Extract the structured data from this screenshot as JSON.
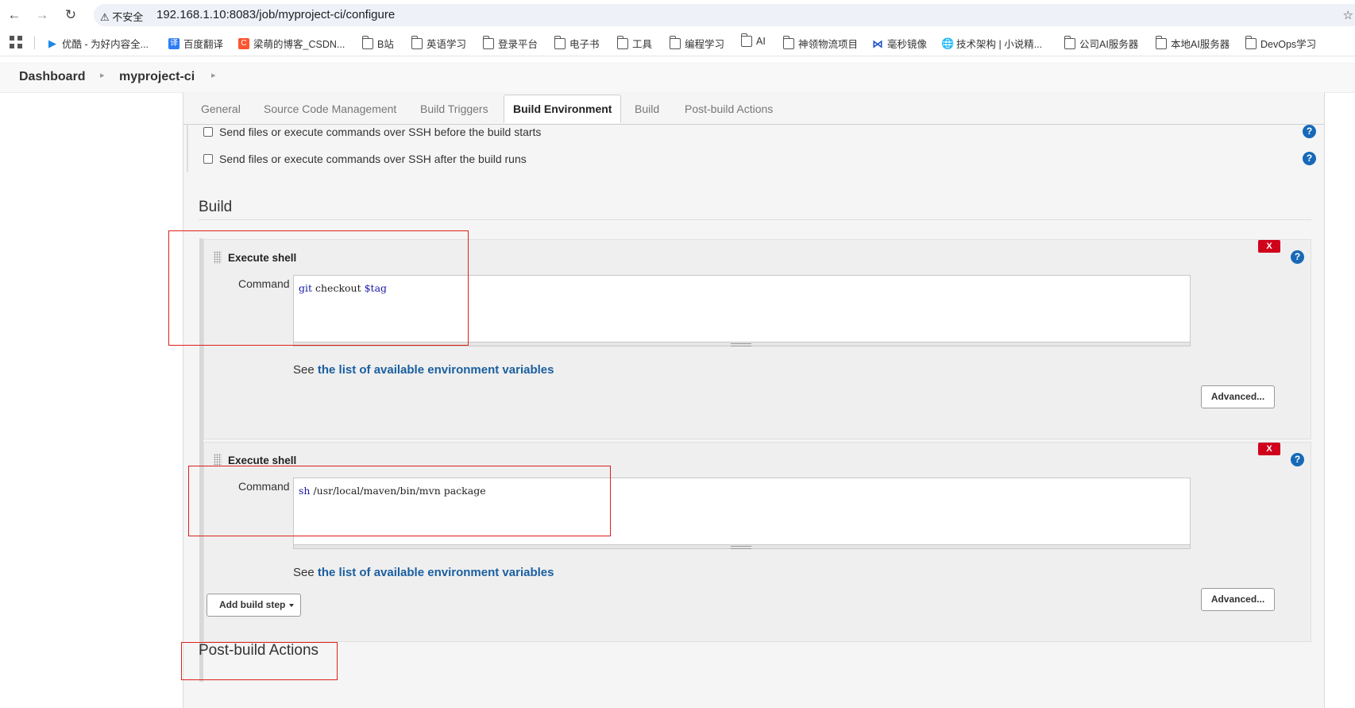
{
  "browser": {
    "security_label": "不安全",
    "url": "192.168.1.10:8083/job/myproject-ci/configure",
    "icons": [
      "back-arrow-icon",
      "forward-arrow-icon",
      "reload-icon",
      "warning-icon",
      "star-icon"
    ]
  },
  "bookmarks": [
    {
      "label": "优酷 - 为好内容全...",
      "icon": "youku-icon",
      "color": "#1e88e5"
    },
    {
      "label": "百度翻译",
      "icon": "baidu-translate-icon",
      "color": "#2d7cf6"
    },
    {
      "label": "梁萌的博客_CSDN...",
      "icon": "csdn-icon",
      "color": "#fc5531"
    },
    {
      "label": "B站",
      "icon": "folder-icon"
    },
    {
      "label": "英语学习",
      "icon": "folder-icon"
    },
    {
      "label": "登录平台",
      "icon": "folder-icon"
    },
    {
      "label": "电子书",
      "icon": "folder-icon"
    },
    {
      "label": "工具",
      "icon": "folder-icon"
    },
    {
      "label": "编程学习",
      "icon": "folder-icon"
    },
    {
      "label": "AI",
      "icon": "folder-icon"
    },
    {
      "label": "神领物流项目",
      "icon": "folder-icon"
    },
    {
      "label": "毫秒镜像",
      "icon": "haomiao-icon",
      "color": "#1e50c8"
    },
    {
      "label": "技术架构 | 小说精...",
      "icon": "globe-icon",
      "color": "#555555"
    },
    {
      "label": "公司AI服务器",
      "icon": "folder-icon"
    },
    {
      "label": "本地AI服务器",
      "icon": "folder-icon"
    },
    {
      "label": "DevOps学习",
      "icon": "folder-icon"
    }
  ],
  "breadcrumb": {
    "items": [
      "Dashboard",
      "myproject-ci"
    ]
  },
  "tabs": [
    "General",
    "Source Code Management",
    "Build Triggers",
    "Build Environment",
    "Build",
    "Post-build Actions"
  ],
  "active_tab": "Build Environment",
  "build_env": {
    "ssh_before": "Send files or execute commands over SSH before the build starts",
    "ssh_after": "Send files or execute commands over SSH after the build runs"
  },
  "build": {
    "section_title": "Build",
    "steps": [
      {
        "title": "Execute shell",
        "command_label": "Command",
        "command_kw": "git",
        "command_rest": " checkout ",
        "command_var": "$tag",
        "see_prefix": "See ",
        "see_link": "the list of available environment variables",
        "advanced_label": "Advanced...",
        "delete_label": "X"
      },
      {
        "title": "Execute shell",
        "command_label": "Command",
        "command_kw": "sh",
        "command_rest": " /usr/local/maven/bin/mvn package",
        "command_var": "",
        "see_prefix": "See ",
        "see_link": "the list of available environment variables",
        "advanced_label": "Advanced...",
        "delete_label": "X"
      }
    ],
    "add_step_label": "Add build step"
  },
  "post_build": {
    "section_title": "Post-build Actions"
  },
  "help_label": "?",
  "colors": {
    "help": "#1769b8",
    "delete": "#d0021b",
    "link": "#1a5fa0",
    "annotation": "#e0201a"
  }
}
